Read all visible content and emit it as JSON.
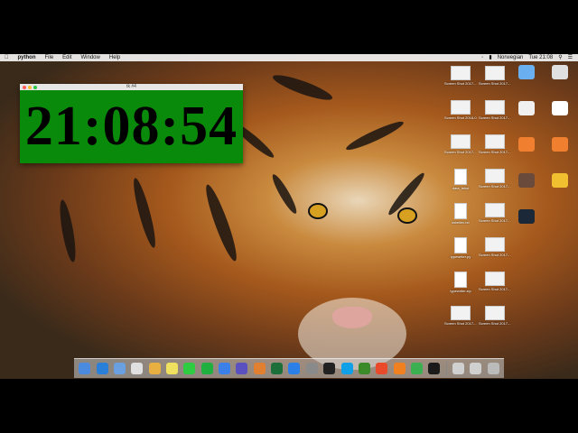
{
  "menubar": {
    "apple": "",
    "app_name": "python",
    "menus": [
      "File",
      "Edit",
      "Window",
      "Help"
    ],
    "keyboard": "Norwegian",
    "clock": "Tue 21:08"
  },
  "window": {
    "title": "tk #4",
    "time": "21:08:54",
    "background_color": "#0a8a0a"
  },
  "desktop_icons": [
    {
      "label": "Screen Shot 2017-...11.55.08",
      "icon": "screenshot-icon"
    },
    {
      "label": "Screen Shot 2017-...11.56.14",
      "icon": "screenshot-icon"
    },
    {
      "label": "Screen Shot 2018-0...11.52.01",
      "icon": "screenshot-icon"
    },
    {
      "label": "Screen Shot 2017-...12.19.1",
      "icon": "screenshot-icon"
    },
    {
      "label": "Screen Shot 2017-...11.56.09",
      "icon": "screenshot-icon"
    },
    {
      "label": "Screen Shot 2017-...12.19.27",
      "icon": "screenshot-icon"
    },
    {
      "label": "data_tekst",
      "icon": "document-icon"
    },
    {
      "label": "Screen Shot 2017-...12.17.26",
      "icon": "screenshot-icon"
    },
    {
      "label": "tabellen.txt",
      "icon": "document-icon"
    },
    {
      "label": "Screen Shot 2017-...12.17.13",
      "icon": "screenshot-icon"
    },
    {
      "label": "typewriter.py",
      "icon": "document-icon"
    },
    {
      "label": "Screen Shot 2017-...12.17.12",
      "icon": "screenshot-icon"
    },
    {
      "label": "typewriter.zip",
      "icon": "archive-icon"
    },
    {
      "label": "Screen Shot 2017-...21.42.06",
      "icon": "screenshot-icon"
    },
    {
      "label": "Screen Shot 2017-...11.34.59",
      "icon": "screenshot-icon"
    },
    {
      "label": "Screen Shot 2017-...10.14.44",
      "icon": "screenshot-icon"
    }
  ],
  "right_icons": [
    "folder-icon",
    "drive-icon",
    "screenshot-icon",
    "document-icon",
    "blender-icon",
    "blender-icon",
    "game-icon",
    "folder-icon",
    "steam-icon"
  ],
  "dock_apps": [
    "finder",
    "safari",
    "preview",
    "photos",
    "chrome",
    "notes",
    "messages",
    "facetime",
    "keynote",
    "imovie",
    "blender",
    "excel",
    "appstore",
    "system-prefs",
    "quicktime",
    "skype",
    "minecraft",
    "chrome2",
    "ibooks",
    "pycharm",
    "terminal",
    "downloads",
    "documents",
    "trash"
  ],
  "colors": {
    "dock": [
      "#4a8be0",
      "#2a7fd8",
      "#6aa0e0",
      "#e0e0e0",
      "#e8b040",
      "#f0e060",
      "#2ecc40",
      "#20b040",
      "#3a80e8",
      "#5a50c0",
      "#e08030",
      "#1d6f3a",
      "#2a80e8",
      "#8a8a8a",
      "#222",
      "#10a0e8",
      "#3a8a2a",
      "#e84a2a",
      "#f08020",
      "#3ab050",
      "#1a1a1a",
      "#d0d0d0",
      "#d0d0d0",
      "#bbbbbb"
    ]
  }
}
